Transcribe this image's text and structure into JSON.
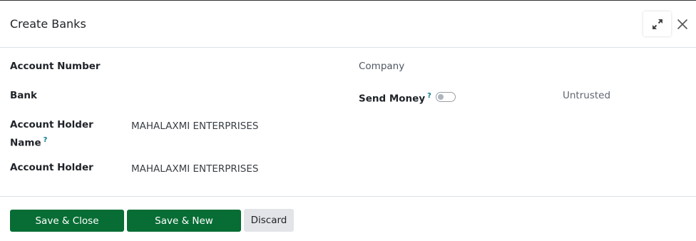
{
  "dialog": {
    "title": "Create Banks"
  },
  "form": {
    "account_number_label": "Account Number",
    "bank_label": "Bank",
    "account_holder_name_label_line1": "Account Holder",
    "account_holder_name_label_line2": "Name",
    "account_holder_name_value": "MAHALAXMI ENTERPRISES",
    "account_holder_label": "Account Holder",
    "account_holder_value": "MAHALAXMI ENTERPRISES",
    "company_label": "Company",
    "send_money_label": "Send Money",
    "send_money_status": "Untrusted",
    "send_money_enabled": false,
    "help_mark": "?"
  },
  "footer": {
    "save_close_label": "Save & Close",
    "save_new_label": "Save & New",
    "discard_label": "Discard"
  },
  "colors": {
    "primary": "#076d34",
    "secondary": "#e2e4e7",
    "help": "#0a7b8a"
  },
  "icons": {
    "expand": "expand-icon",
    "close": "close-icon",
    "toggle": "toggle-switch"
  }
}
